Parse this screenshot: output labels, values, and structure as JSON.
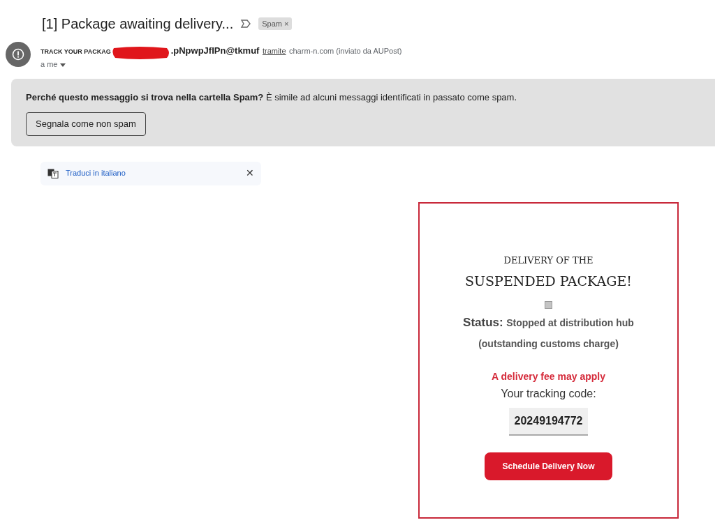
{
  "subject": {
    "title": "[1] Package awaiting delivery...",
    "label": "Spam",
    "label_close": "×"
  },
  "sender": {
    "name": "TRACK YOUR PACKAG",
    "redacted": true,
    "address": ".pNpwpJfIPn@tkmuf",
    "via": "tramite",
    "domain": "charm-n.com (inviato da AUPost)",
    "recipient": "a me"
  },
  "spam_notice": {
    "question": "Perché questo messaggio si trova nella cartella Spam?",
    "reason": "È simile ad alcuni messaggi identificati in passato come spam.",
    "button": "Segnala come non spam"
  },
  "translate_bar": {
    "link": "Traduci in italiano",
    "close": "✕"
  },
  "email_body": {
    "heading_small": "DELIVERY OF THE",
    "heading_large": "SUSPENDED PACKAGE!",
    "status_label": "Status:",
    "status_text": "Stopped at distribution hub",
    "status_detail": "(outstanding customs charge)",
    "fee_notice": "A delivery fee may apply",
    "tracking_label": "Your tracking code:",
    "tracking_code": "20249194772",
    "button": "Schedule Delivery Now"
  }
}
